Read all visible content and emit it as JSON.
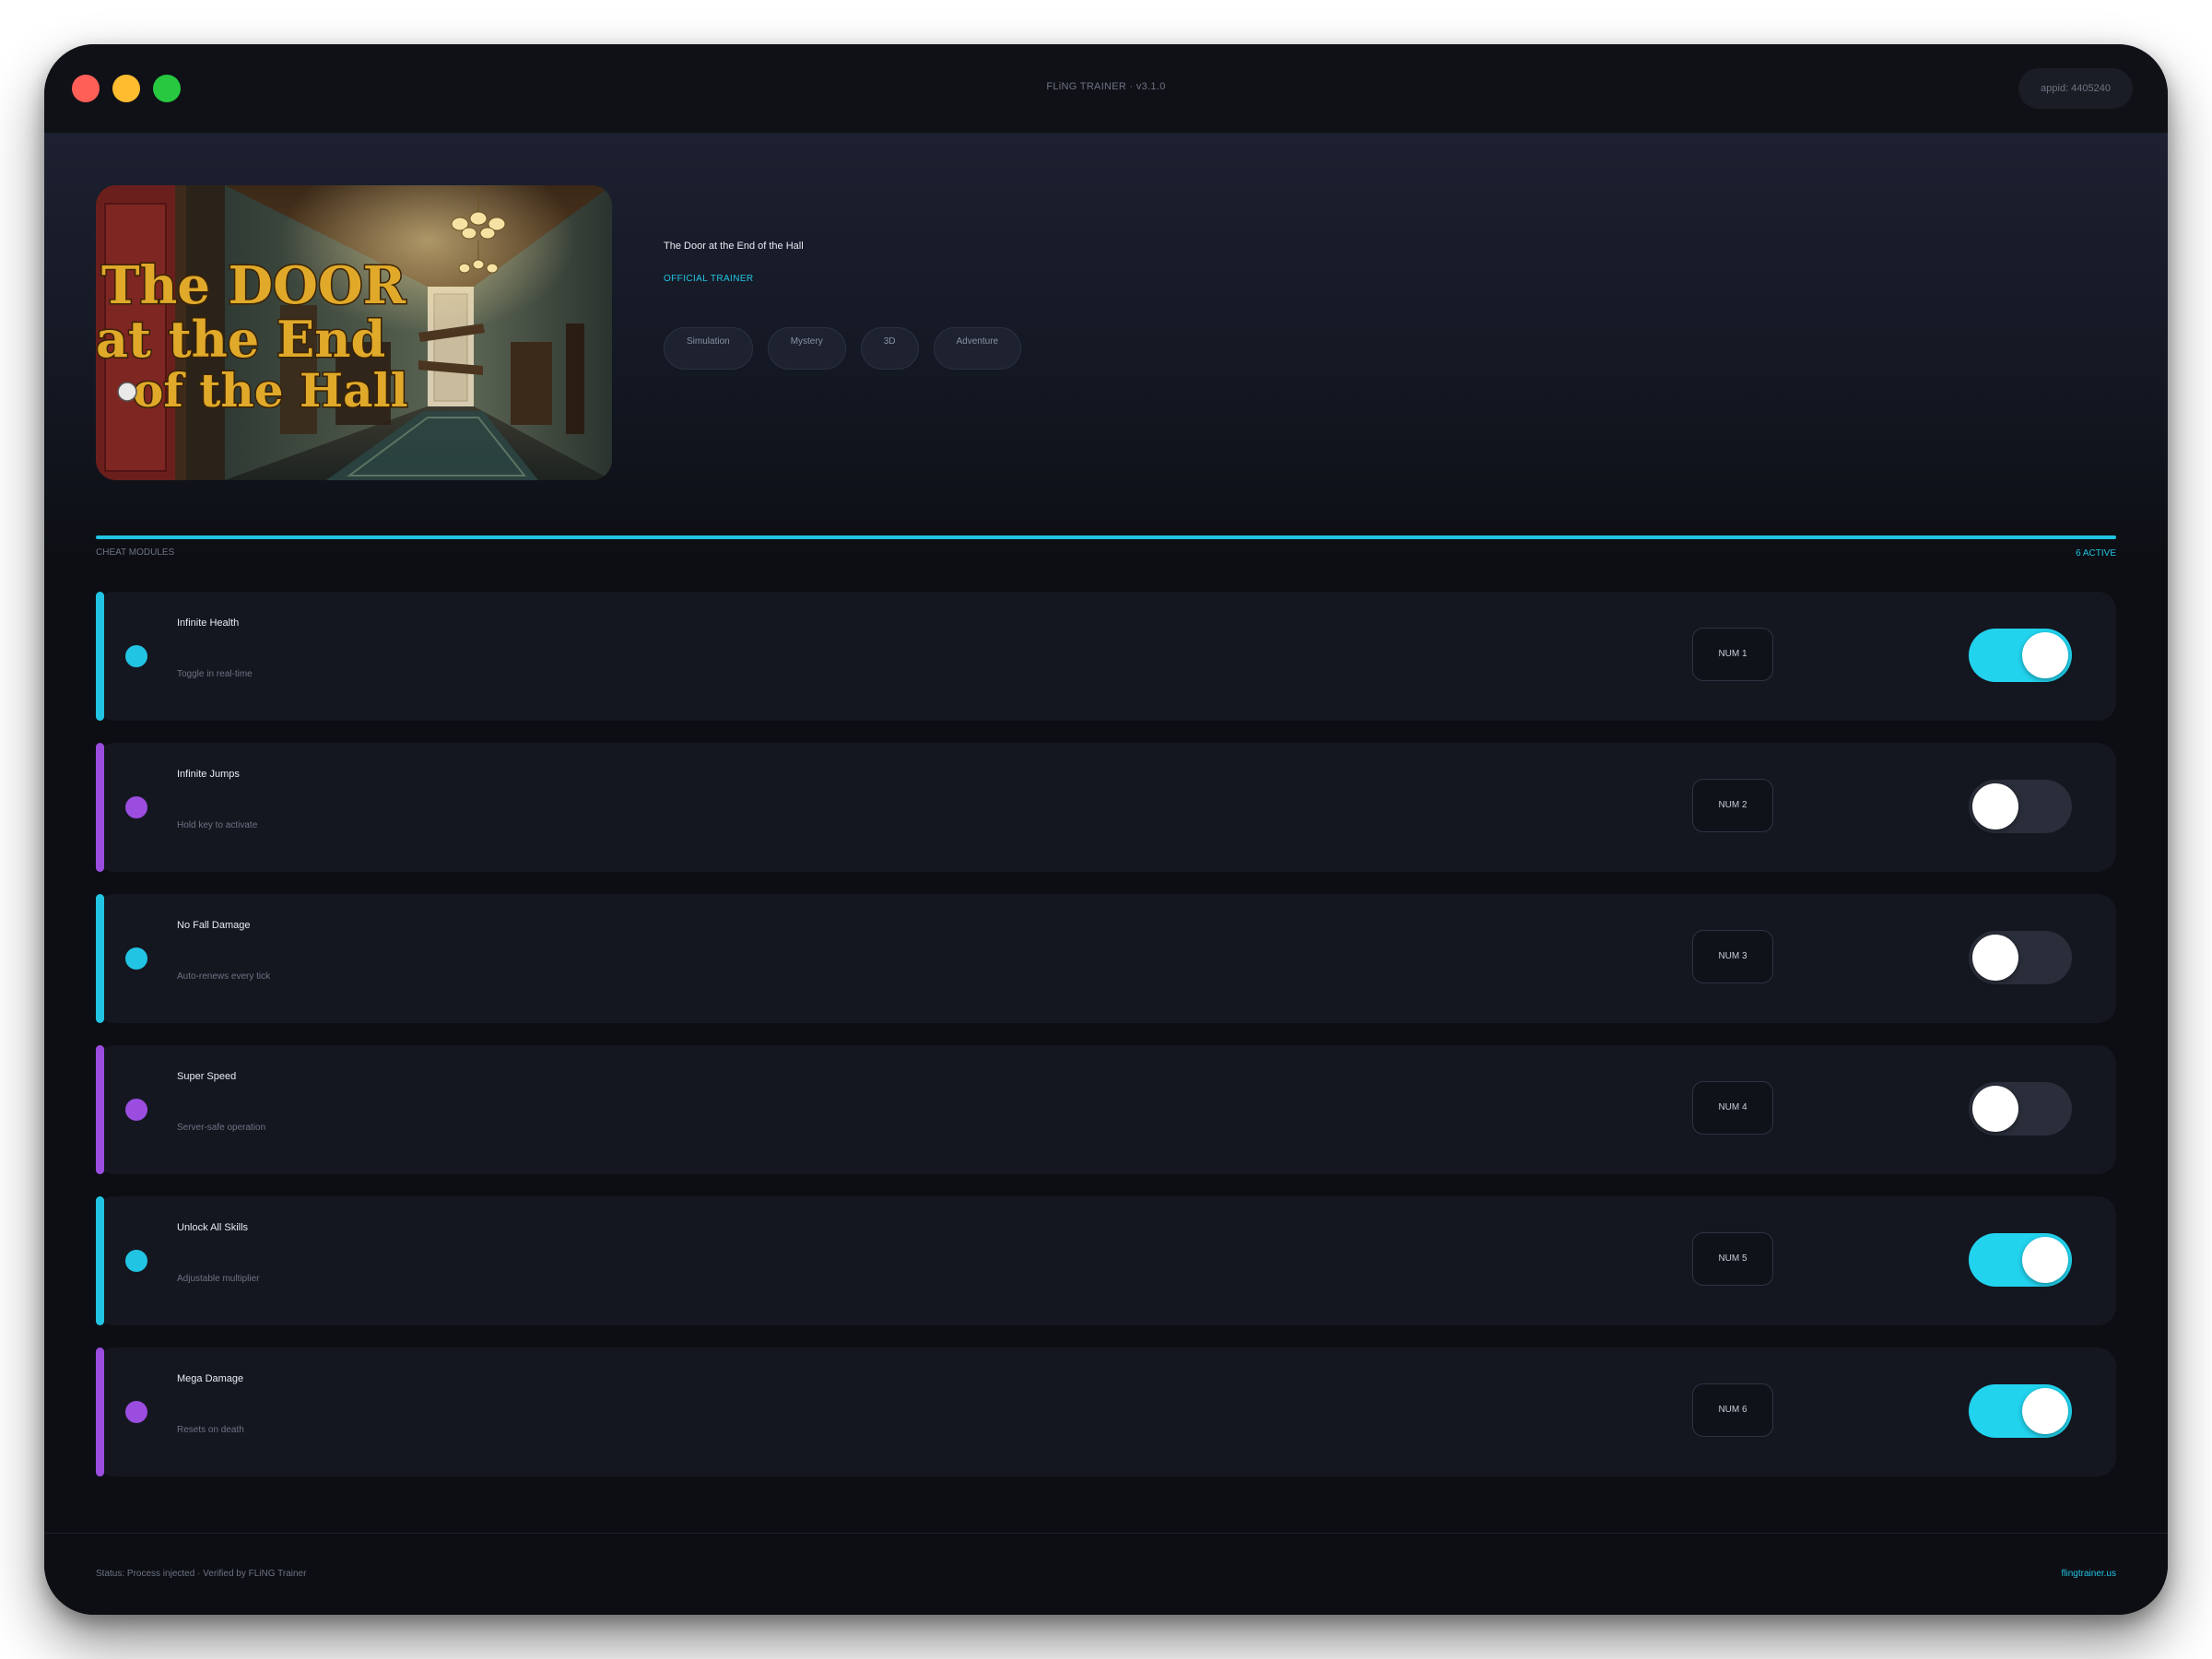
{
  "window": {
    "title": "FLiNG TRAINER · v3.1.0",
    "appid": "appid: 4405240"
  },
  "game": {
    "title": "The Door at the End of the Hall",
    "badge": "OFFICIAL TRAINER",
    "tags": [
      "Simulation",
      "Mystery",
      "3D",
      "Adventure"
    ],
    "cover_logo": [
      "The DOOR",
      "at the End",
      "of the Hall"
    ]
  },
  "modules": {
    "label": "CHEAT MODULES",
    "active_count": "6 ACTIVE",
    "items": [
      {
        "name": "Infinite Health",
        "desc": "Toggle in real-time",
        "hotkey": "NUM 1",
        "on": true,
        "accent": "#22c4e3"
      },
      {
        "name": "Infinite Jumps",
        "desc": "Hold key to activate",
        "hotkey": "NUM 2",
        "on": false,
        "accent": "#9b4de0"
      },
      {
        "name": "No Fall Damage",
        "desc": "Auto-renews every tick",
        "hotkey": "NUM 3",
        "on": false,
        "accent": "#22c4e3"
      },
      {
        "name": "Super Speed",
        "desc": "Server-safe operation",
        "hotkey": "NUM 4",
        "on": false,
        "accent": "#9b4de0"
      },
      {
        "name": "Unlock All Skills",
        "desc": "Adjustable multiplier",
        "hotkey": "NUM 5",
        "on": true,
        "accent": "#22c4e3"
      },
      {
        "name": "Mega Damage",
        "desc": "Resets on death",
        "hotkey": "NUM 6",
        "on": true,
        "accent": "#9b4de0"
      }
    ]
  },
  "footer": {
    "status": "Status: Process injected · Verified by FLiNG Trainer",
    "site": "flingtrainer.us"
  },
  "colors": {
    "accent_cyan": "#22c4e3",
    "accent_purple": "#9b4de0",
    "toggle_on": "#22d3ee",
    "toggle_off": "#2a2e3a"
  }
}
